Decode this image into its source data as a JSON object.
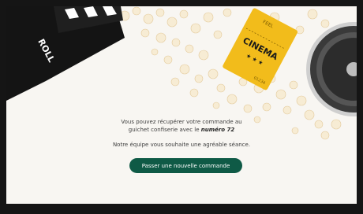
{
  "decor": {
    "clapperboard_text": "ROLL",
    "ticket_title": "CINEMA",
    "ticket_top_text": "FEEL",
    "ticket_number": "01234"
  },
  "confirmation": {
    "line1": "Vous pouvez récupérer votre commande au",
    "line2_prefix": "guichet confiserie avec le ",
    "order_number": "numéro 72",
    "team_message": "Notre équipe vous souhaite une agréable séance."
  },
  "actions": {
    "new_order_label": "Passer une nouvelle commande"
  },
  "colors": {
    "button": "#0f5a46",
    "ticket": "#f2bc1b",
    "clapperboard": "#141414",
    "bezel": "#151515"
  }
}
